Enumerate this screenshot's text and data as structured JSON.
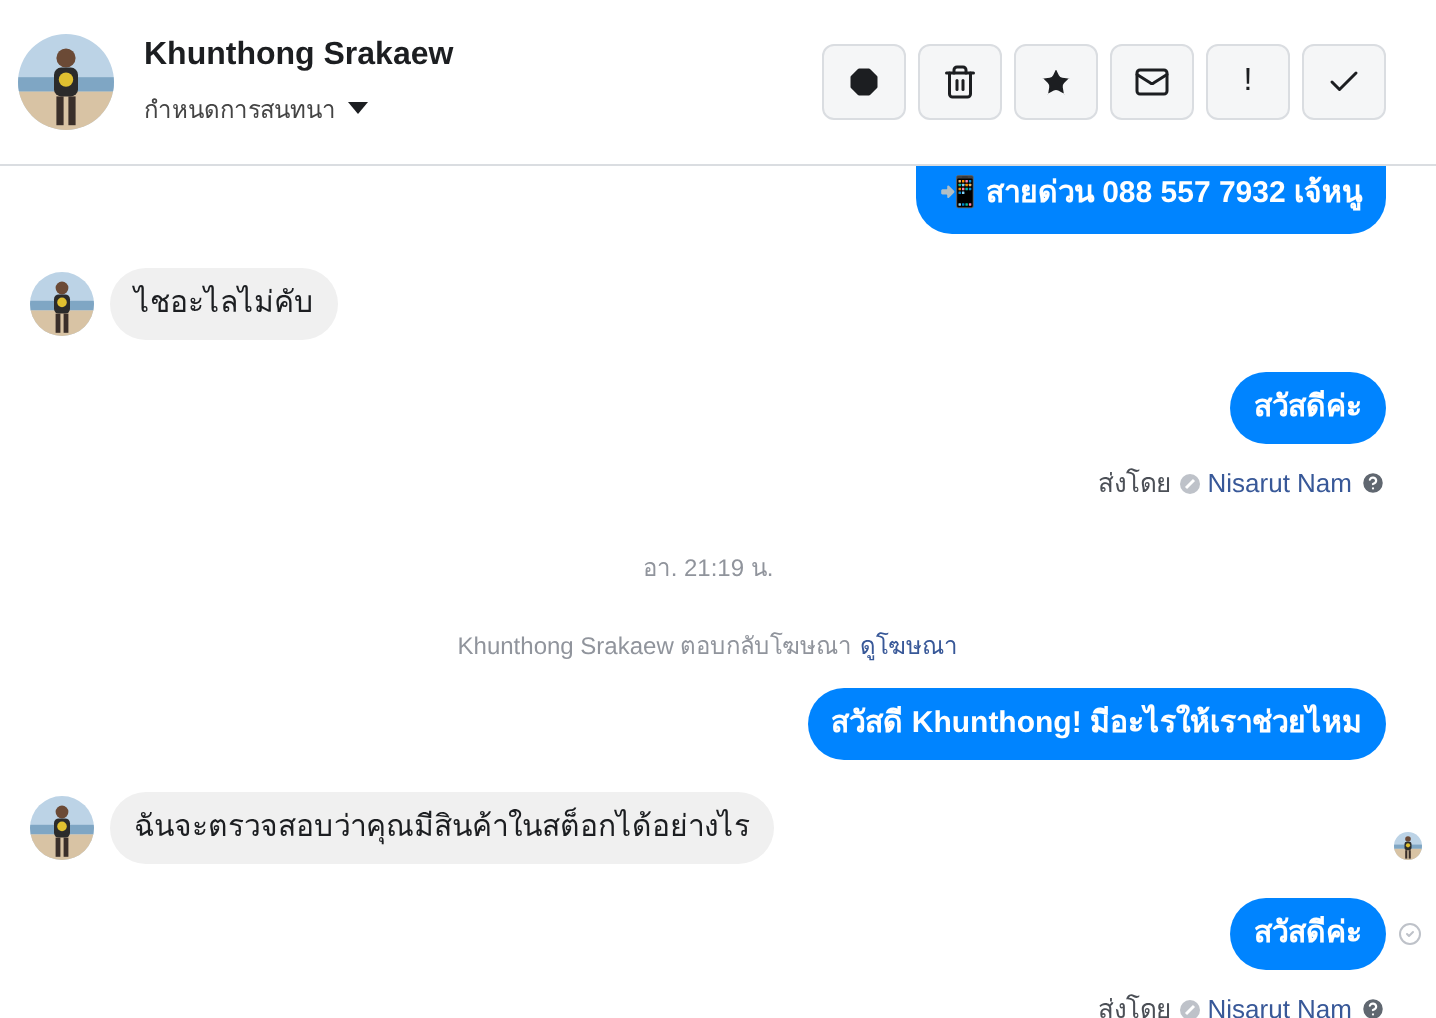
{
  "header": {
    "name": "Khunthong Srakaew",
    "subtitle": "กำหนดการสนทนา",
    "actions": [
      {
        "kind": "report"
      },
      {
        "kind": "delete"
      },
      {
        "kind": "star"
      },
      {
        "kind": "mail"
      },
      {
        "kind": "text",
        "label": "!"
      },
      {
        "kind": "done"
      }
    ]
  },
  "messages": [
    {
      "kind": "outgoing",
      "text": "📲 สายด่วน 088 557 7932 เจ้หนู",
      "cut": true
    },
    {
      "kind": "incoming",
      "text": "ไชอะไลไม่คับ"
    },
    {
      "kind": "outgoing",
      "text": "สวัสดีค่ะ"
    },
    {
      "kind": "meta",
      "prefix": "ส่งโดย",
      "sender": "Nisarut Nam"
    },
    {
      "kind": "time",
      "text": "อา. 21:19 น."
    },
    {
      "kind": "notice",
      "text": "Khunthong Srakaew ตอบกลับโฆษณา",
      "link": "ดูโฆษณา"
    },
    {
      "kind": "outgoing",
      "text": "สวัสดี Khunthong! มีอะไรให้เราช่วยไหม"
    },
    {
      "kind": "incoming",
      "text": "ฉันจะตรวจสอบว่าคุณมีสินค้าในสต็อกได้อย่างไร",
      "seen": true
    },
    {
      "kind": "outgoing",
      "text": "สวัสดีค่ะ",
      "delivered": true
    },
    {
      "kind": "meta",
      "prefix": "ส่งโดย",
      "sender": "Nisarut Nam"
    }
  ]
}
